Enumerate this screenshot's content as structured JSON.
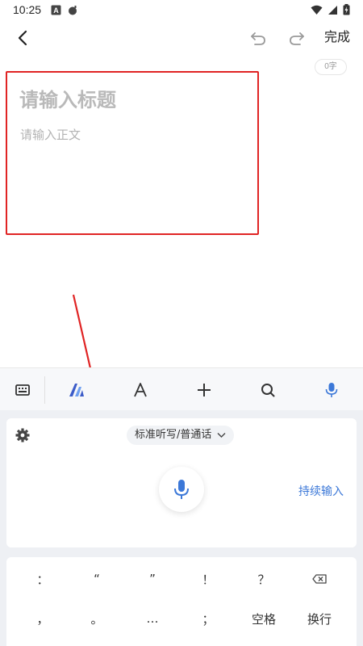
{
  "status_bar": {
    "time": "10:25",
    "icons": [
      "text-app-icon",
      "bomb-icon",
      "wifi-icon",
      "signal-icon",
      "battery-charging-icon"
    ]
  },
  "app_bar": {
    "back_icon": "chevron-left-icon",
    "undo_icon": "undo-icon",
    "redo_icon": "redo-icon",
    "done_label": "完成"
  },
  "editor": {
    "word_count": "0字",
    "title_placeholder": "请输入标题",
    "body_placeholder": "请输入正文"
  },
  "toolbar": {
    "items": [
      "keyboard-icon",
      "ai-logo-icon",
      "font-icon",
      "plus-icon",
      "search-icon",
      "microphone-icon"
    ],
    "active_item": "microphone-icon"
  },
  "voice_panel": {
    "settings_icon": "gear-icon",
    "mode_label": "标准听写/普通话",
    "continuous_label": "持续输入"
  },
  "keys": {
    "row1": [
      "：",
      "“",
      "”",
      "！",
      "？"
    ],
    "row1_last_icon": "backspace-icon",
    "row2": [
      "，",
      "。",
      "…",
      "；",
      "空格",
      "换行"
    ]
  },
  "colors": {
    "accent_blue": "#3c78d8",
    "annotation_red": "#e02424",
    "placeholder_gray": "#b9b9b9"
  }
}
